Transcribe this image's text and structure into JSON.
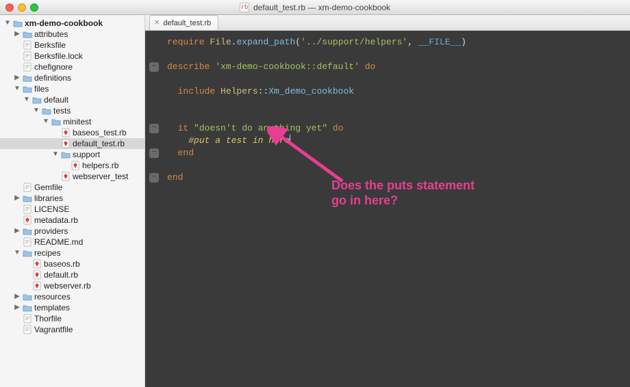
{
  "window": {
    "title": "default_test.rb — xm-demo-cookbook",
    "filetype_badge": "rb"
  },
  "tab": {
    "label": "default_test.rb"
  },
  "tree": [
    {
      "depth": 0,
      "disclosure": "down",
      "kind": "folder",
      "name": "xm-demo-cookbook",
      "bold": true
    },
    {
      "depth": 1,
      "disclosure": "right",
      "kind": "folder",
      "name": "attributes"
    },
    {
      "depth": 1,
      "disclosure": "none",
      "kind": "file",
      "name": "Berksfile"
    },
    {
      "depth": 1,
      "disclosure": "none",
      "kind": "file",
      "name": "Berksfile.lock"
    },
    {
      "depth": 1,
      "disclosure": "none",
      "kind": "file",
      "name": "chefignore"
    },
    {
      "depth": 1,
      "disclosure": "right",
      "kind": "folder",
      "name": "definitions"
    },
    {
      "depth": 1,
      "disclosure": "down",
      "kind": "folder",
      "name": "files"
    },
    {
      "depth": 2,
      "disclosure": "down",
      "kind": "folder",
      "name": "default"
    },
    {
      "depth": 3,
      "disclosure": "down",
      "kind": "folder",
      "name": "tests"
    },
    {
      "depth": 4,
      "disclosure": "down",
      "kind": "folder",
      "name": "minitest"
    },
    {
      "depth": 5,
      "disclosure": "none",
      "kind": "ruby",
      "name": "baseos_test.rb"
    },
    {
      "depth": 5,
      "disclosure": "none",
      "kind": "ruby",
      "name": "default_test.rb",
      "selected": true
    },
    {
      "depth": 5,
      "disclosure": "down",
      "kind": "folder",
      "name": "support"
    },
    {
      "depth": 6,
      "disclosure": "none",
      "kind": "ruby",
      "name": "helpers.rb"
    },
    {
      "depth": 5,
      "disclosure": "none",
      "kind": "ruby",
      "name": "webserver_test"
    },
    {
      "depth": 1,
      "disclosure": "none",
      "kind": "file",
      "name": "Gemfile"
    },
    {
      "depth": 1,
      "disclosure": "right",
      "kind": "folder",
      "name": "libraries"
    },
    {
      "depth": 1,
      "disclosure": "none",
      "kind": "file",
      "name": "LICENSE"
    },
    {
      "depth": 1,
      "disclosure": "none",
      "kind": "ruby",
      "name": "metadata.rb"
    },
    {
      "depth": 1,
      "disclosure": "right",
      "kind": "folder",
      "name": "providers"
    },
    {
      "depth": 1,
      "disclosure": "none",
      "kind": "file",
      "name": "README.md"
    },
    {
      "depth": 1,
      "disclosure": "down",
      "kind": "folder",
      "name": "recipes"
    },
    {
      "depth": 2,
      "disclosure": "none",
      "kind": "ruby",
      "name": "baseos.rb"
    },
    {
      "depth": 2,
      "disclosure": "none",
      "kind": "ruby",
      "name": "default.rb"
    },
    {
      "depth": 2,
      "disclosure": "none",
      "kind": "ruby",
      "name": "webserver.rb"
    },
    {
      "depth": 1,
      "disclosure": "right",
      "kind": "folder",
      "name": "resources"
    },
    {
      "depth": 1,
      "disclosure": "right",
      "kind": "folder",
      "name": "templates"
    },
    {
      "depth": 1,
      "disclosure": "none",
      "kind": "file",
      "name": "Thorfile"
    },
    {
      "depth": 1,
      "disclosure": "none",
      "kind": "file",
      "name": "Vagrantfile"
    }
  ],
  "code": {
    "line1_require": "require",
    "line1_file": "File",
    "line1_expand": "expand_path",
    "line1_arg1": "'../support/helpers'",
    "line1_arg2": "__FILE__",
    "line3_describe": "describe",
    "line3_str": "'xm-demo-cookbook::default'",
    "line3_do": "do",
    "line5_include": "include",
    "line5_helpers": "Helpers",
    "line5_mod": "Xm_demo_cookbook",
    "line8_it": "it",
    "line8_str": "\"doesn't do anything yet\"",
    "line8_do": "do",
    "line9_comment": "#put a test in here",
    "line10_end": "end",
    "line12_end": "end"
  },
  "gutter": {
    "folds": [
      false,
      false,
      true,
      false,
      false,
      false,
      false,
      true,
      false,
      true,
      false,
      true
    ]
  },
  "annotation": {
    "line1": "Does the puts statement",
    "line2": "go in here?"
  }
}
